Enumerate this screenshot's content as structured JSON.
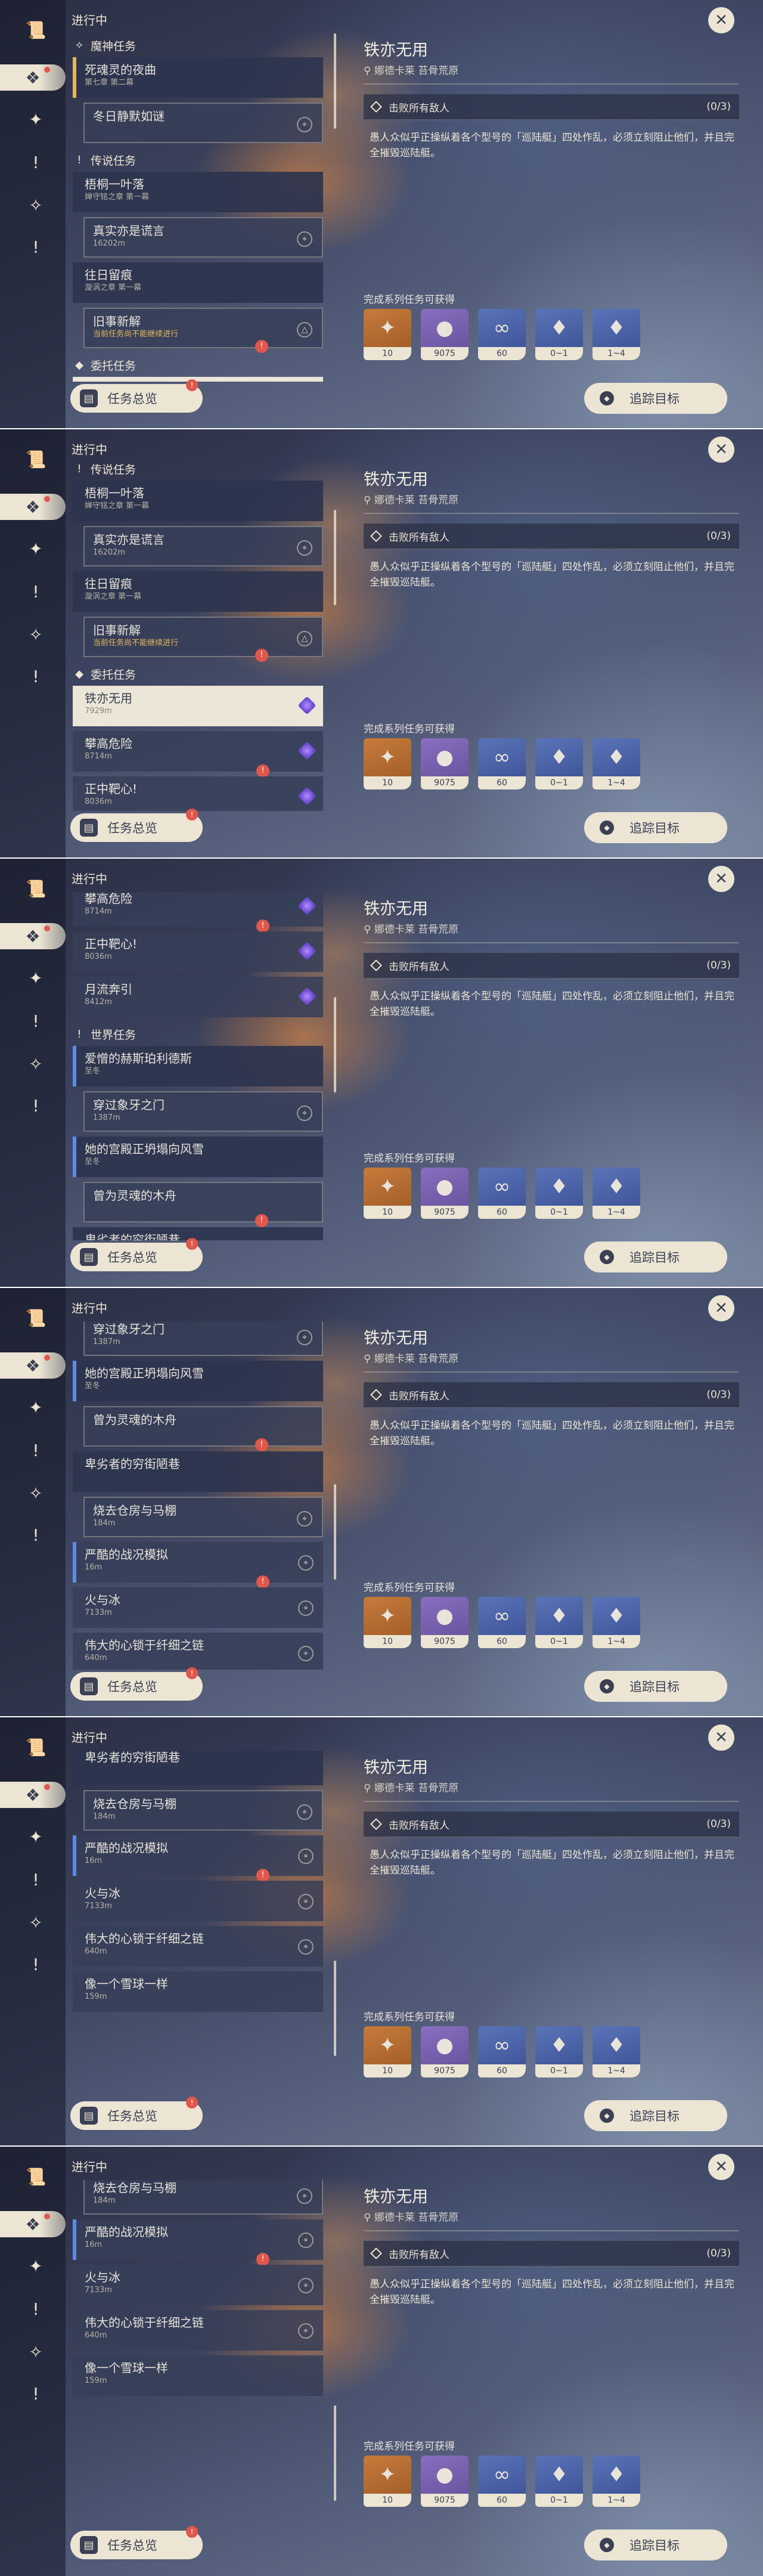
{
  "rail": {
    "items": [
      {
        "icon": "scroll-icon",
        "glyph": "📜"
      },
      {
        "icon": "quest-diamond-icon",
        "glyph": "❖",
        "active": true
      },
      {
        "icon": "compass-icon",
        "glyph": "✦"
      },
      {
        "icon": "exclaim-icon",
        "glyph": "!"
      },
      {
        "icon": "world-icon",
        "glyph": "✧"
      },
      {
        "icon": "exclaim-icon",
        "glyph": "!"
      }
    ]
  },
  "list": {
    "header": "进行中",
    "overview_label": "任务总览",
    "overview_badge": "!",
    "quests": [
      {
        "kind": "section",
        "icon": "archon-icon",
        "glyph": "✧",
        "title": "魔神任务"
      },
      {
        "kind": "parent",
        "style": "ar",
        "title": "死魂灵的夜曲",
        "sub": "第七章 第二幕"
      },
      {
        "kind": "child",
        "title": "冬日静默如谜",
        "sub": "",
        "right": "pin"
      },
      {
        "kind": "section",
        "icon": "legend-icon",
        "glyph": "!",
        "title": "传说任务"
      },
      {
        "kind": "parent",
        "style": "",
        "title": "梧桐一叶落",
        "sub": "婵守铭之章 第一幕"
      },
      {
        "kind": "child",
        "title": "真实亦是谎言",
        "sub": "16202m",
        "right": "pin"
      },
      {
        "kind": "parent",
        "style": "",
        "title": "往日留痕",
        "sub": "漩涡之章 第一幕"
      },
      {
        "kind": "child",
        "title": "旧事新解",
        "sub": "当前任务尚不能继续进行",
        "warn": true,
        "right": "warn",
        "badge": true
      },
      {
        "kind": "section",
        "icon": "commission-icon",
        "glyph": "◆",
        "title": "委托任务"
      },
      {
        "kind": "item",
        "selected": true,
        "title": "铁亦无用",
        "sub": "7929m",
        "right": "purple"
      },
      {
        "kind": "item",
        "title": "攀高危险",
        "sub": "8714m",
        "right": "purple",
        "badge": true
      },
      {
        "kind": "item",
        "title": "正中靶心!",
        "sub": "8036m",
        "right": "purple"
      },
      {
        "kind": "item",
        "title": "月流奔引",
        "sub": "8412m",
        "right": "purple"
      },
      {
        "kind": "section",
        "icon": "world-quest-icon",
        "glyph": "!",
        "title": "世界任务"
      },
      {
        "kind": "parent",
        "style": "world",
        "title": "爱憎的赫斯珀利德斯",
        "sub": "至冬"
      },
      {
        "kind": "child",
        "title": "穿过象牙之门",
        "sub": "1387m",
        "right": "pin"
      },
      {
        "kind": "parent",
        "style": "world",
        "title": "她的宫殿正坍塌向风雪",
        "sub": "至冬"
      },
      {
        "kind": "child",
        "title": "曾为灵魂的木舟",
        "sub": "",
        "right": "",
        "badge": true
      },
      {
        "kind": "parent",
        "style": "",
        "title": "卑劣者的穷街陋巷",
        "sub": ""
      },
      {
        "kind": "child",
        "title": "烧去仓房与马棚",
        "sub": "184m",
        "right": "pin"
      },
      {
        "kind": "item",
        "style": "world",
        "title": "严酷的战况模拟",
        "sub": "16m",
        "right": "pin",
        "badge": true
      },
      {
        "kind": "item",
        "title": "火与冰",
        "sub": "7133m",
        "right": "pin"
      },
      {
        "kind": "item",
        "title": "伟大的心锁于纤细之链",
        "sub": "640m",
        "right": "pin"
      },
      {
        "kind": "item",
        "title": "像一个雪球一样",
        "sub": "159m",
        "right": ""
      }
    ]
  },
  "detail": {
    "title": "铁亦无用",
    "location": "娜德卡莱 苔骨荒原",
    "objective": "击败所有敌人",
    "objective_count": "(0/3)",
    "description": "愚人众似乎正操纵着各个型号的「巡陆艇」四处作乱，必须立刻阻止他们，并且完全摧毁巡陆艇。",
    "rewards_header": "完成系列任务可获得",
    "rewards": [
      {
        "icon": "adventure-exp-icon",
        "glyph": "✦",
        "amount": "10",
        "bg": "orange"
      },
      {
        "icon": "mora-coin-icon",
        "glyph": "●",
        "amount": "9075",
        "bg": "purple"
      },
      {
        "icon": "companionship-exp-icon",
        "glyph": "∞",
        "amount": "60",
        "bg": "blue"
      },
      {
        "icon": "crystal-purple-icon",
        "glyph": "♦",
        "amount": "0~1",
        "bg": "blue"
      },
      {
        "icon": "crystal-pink-icon",
        "glyph": "♦",
        "amount": "1~4",
        "bg": "blue"
      }
    ],
    "track_label": "追踪目标",
    "close_glyph": "✕"
  },
  "frames": [
    {
      "scroll_index": 0,
      "scrollbar_top": 0.0
    },
    {
      "scroll_index": 3,
      "scrollbar_top": 0.18
    },
    {
      "scroll_index": 10,
      "scrollbar_top": 0.4
    },
    {
      "scroll_index": 15,
      "scrollbar_top": 0.62
    },
    {
      "scroll_index": 18,
      "scrollbar_top": 0.8
    },
    {
      "scroll_index": 19,
      "scrollbar_top": 0.86
    }
  ]
}
